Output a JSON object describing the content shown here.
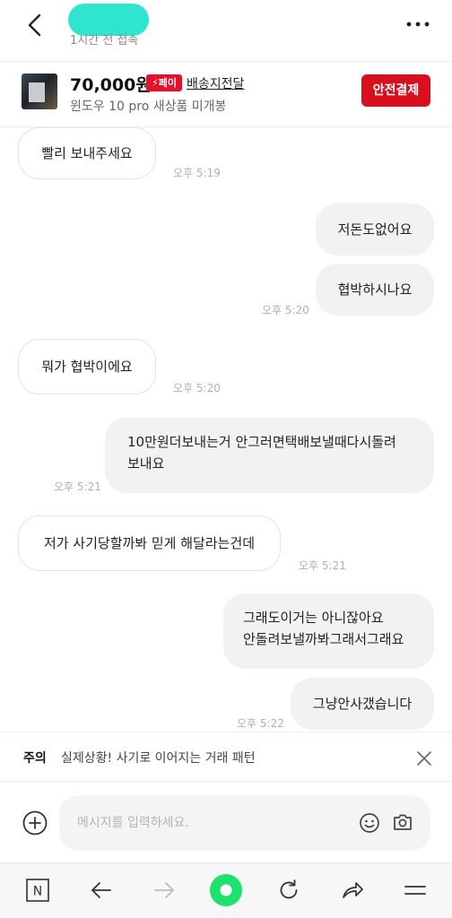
{
  "header": {
    "last_access": "1시간 전 접속"
  },
  "product": {
    "price": "70,000원",
    "pay_badge": "⚡페이",
    "shipping": "배송지전달",
    "name": "윈도우 10 pro 새상품 미개봉",
    "safe_pay_label": "안전결제"
  },
  "messages": [
    {
      "dir": "in",
      "text": "빨리 보내주세요",
      "time": "오후 5:19"
    },
    {
      "dir": "out",
      "text": "저돈도없어요",
      "time": ""
    },
    {
      "dir": "out",
      "text": "협박하시나요",
      "time": "오후 5:20"
    },
    {
      "dir": "in",
      "text": "뭐가 협박이에요",
      "time": "오후 5:20"
    },
    {
      "dir": "out",
      "text": "10만원더보내는거 안그러면택배보낼때다시돌려\n보내요",
      "time": "오후 5:21"
    },
    {
      "dir": "in",
      "text": "저가 사기당할까봐 믿게 해달라는건데",
      "time": "오후 5:21"
    },
    {
      "dir": "out",
      "text": "그래도이거는 아니잖아요\n안돌려보낼까봐그래서그래요",
      "time": ""
    },
    {
      "dir": "out",
      "text": "그냥안사갰습니다",
      "time": "오후 5:22"
    }
  ],
  "warning": {
    "label": "주의",
    "text": "실제상황! 사기로 이어지는 거래 패턴"
  },
  "input": {
    "placeholder": "메시지를 입력하세요."
  },
  "navbar": {
    "home_label": "N"
  },
  "colors": {
    "accent_red": "#d90f1d",
    "badge_red": "#e4112a",
    "name_highlight": "#2ee6cf",
    "nav_green": "#1ee26e"
  },
  "icons": {
    "back": "back-arrow-icon",
    "more": "more-dots-icon",
    "close": "close-icon",
    "add": "plus-circle-icon",
    "emoji": "smiley-icon",
    "camera": "camera-icon"
  }
}
